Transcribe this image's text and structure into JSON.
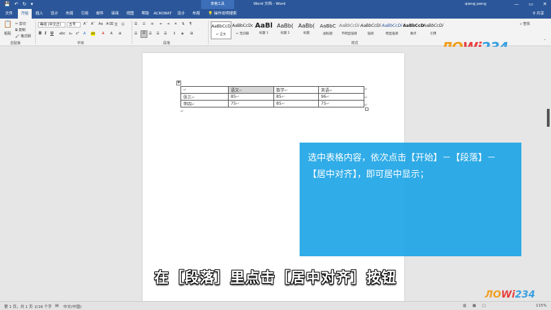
{
  "titlebar": {
    "context_tab": "表格工具",
    "document_title": "Word 文档 - Word",
    "user": "qiang peng",
    "win_min": "—",
    "win_max": "▭",
    "win_close": "✕"
  },
  "tabs": [
    "文件",
    "开始",
    "插入",
    "设计",
    "布局",
    "引用",
    "邮件",
    "审阅",
    "视图",
    "帮助",
    "ACROBAT",
    "设计",
    "布局"
  ],
  "tell_me": "操作说明搜索",
  "share": "共享",
  "ribbon": {
    "clipboard": {
      "label": "剪贴板",
      "paste": "粘贴",
      "cut": "剪切",
      "copy": "复制",
      "format_painter": "格式刷"
    },
    "font": {
      "label": "字体",
      "font_name": "等线 (中文正)",
      "font_size": "五号",
      "bold": "B",
      "italic": "I",
      "underline": "U"
    },
    "paragraph": {
      "label": "段落"
    },
    "styles": {
      "label": "样式",
      "items": [
        {
          "sample": "AaBbCcDd",
          "name": "↵ 正文"
        },
        {
          "sample": "AaBbCcDd",
          "name": "↵ 无间隔"
        },
        {
          "sample": "AaBl",
          "name": "标题 1"
        },
        {
          "sample": "AaBb(",
          "name": "标题 2"
        },
        {
          "sample": "AaBb(",
          "name": "标题"
        },
        {
          "sample": "AaBbC",
          "name": "副标题"
        },
        {
          "sample": "AaBbCcDi",
          "name": "不明显强调"
        },
        {
          "sample": "AaBbCcDi",
          "name": "强调"
        },
        {
          "sample": "AaBbCcDi",
          "name": "明显强调"
        },
        {
          "sample": "AaBbCcD",
          "name": "要点"
        },
        {
          "sample": "AaBbCcDi",
          "name": "引用"
        }
      ]
    },
    "editing": {
      "find": "查找"
    },
    "logo": "ЛOWi234"
  },
  "table": {
    "header": [
      "",
      "语文",
      "数学",
      "英语"
    ],
    "rows": [
      [
        "张三",
        "85",
        "85",
        "96"
      ],
      [
        "李四",
        "75",
        "85",
        "75"
      ]
    ]
  },
  "callout": "选中表格内容，依次点击【开始】－【段落】－【居中对齐】，即可居中显示；",
  "subtitle": "在［段落］里点击［居中对齐］按钮",
  "status": {
    "page": "第 1 页，共 1 页",
    "words": "2/16 个字",
    "language": "中文(中国)",
    "zoom": "115%"
  },
  "colors": {
    "accent": "#2b579a",
    "callout": "#1ea5e6"
  },
  "logo2": "ЛOWi234"
}
